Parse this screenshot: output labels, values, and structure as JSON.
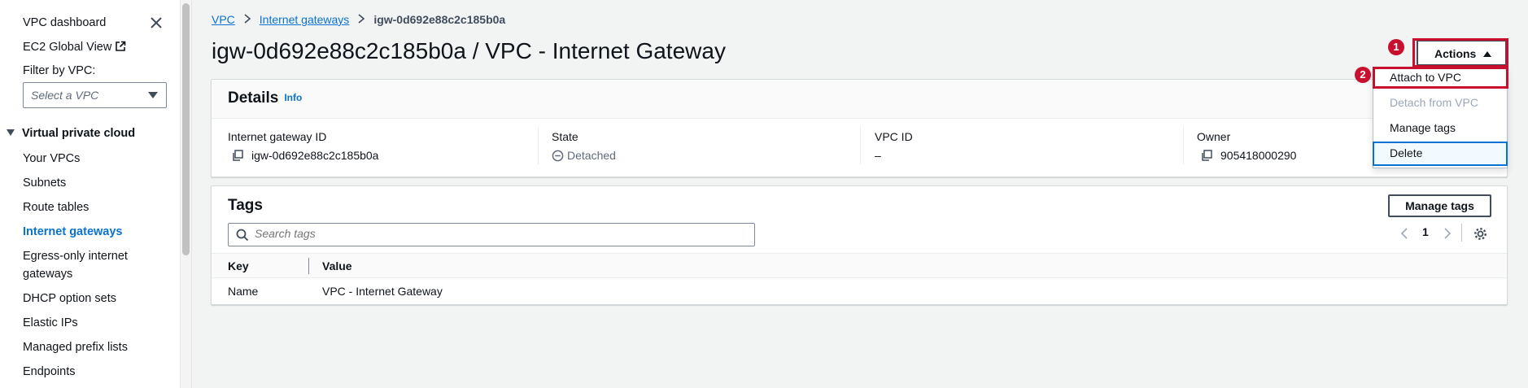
{
  "sidebar": {
    "dashboard": "VPC dashboard",
    "ec2_global_view": "EC2 Global View",
    "filter_label": "Filter by VPC:",
    "filter_placeholder": "Select a VPC",
    "section": "Virtual private cloud",
    "items": [
      {
        "label": "Your VPCs"
      },
      {
        "label": "Subnets"
      },
      {
        "label": "Route tables"
      },
      {
        "label": "Internet gateways"
      },
      {
        "label": "Egress-only internet"
      },
      {
        "label": "gateways"
      },
      {
        "label": "DHCP option sets"
      },
      {
        "label": "Elastic IPs"
      },
      {
        "label": "Managed prefix lists"
      },
      {
        "label": "Endpoints"
      }
    ]
  },
  "breadcrumb": {
    "root": "VPC",
    "parent": "Internet gateways",
    "current": "igw-0d692e88c2c185b0a"
  },
  "page_title": "igw-0d692e88c2c185b0a / VPC - Internet Gateway",
  "actions": {
    "label": "Actions",
    "menu": [
      {
        "label": "Attach to VPC"
      },
      {
        "label": "Detach from VPC"
      },
      {
        "label": "Manage tags"
      },
      {
        "label": "Delete"
      }
    ]
  },
  "callouts": [
    "1",
    "2"
  ],
  "details": {
    "title": "Details",
    "info": "Info",
    "fields": [
      {
        "key": "Internet gateway ID",
        "value": "igw-0d692e88c2c185b0a"
      },
      {
        "key": "State",
        "value": "Detached"
      },
      {
        "key": "VPC ID",
        "value": "–"
      },
      {
        "key": "Owner",
        "value": "905418000290"
      }
    ]
  },
  "tags": {
    "title": "Tags",
    "manage_button": "Manage tags",
    "search_placeholder": "Search tags",
    "page": "1",
    "columns": [
      "Key",
      "Value"
    ],
    "rows": [
      {
        "key": "Name",
        "value": "VPC - Internet Gateway"
      }
    ]
  },
  "colors": {
    "link": "#0972d3",
    "highlight": "#c8102e"
  }
}
